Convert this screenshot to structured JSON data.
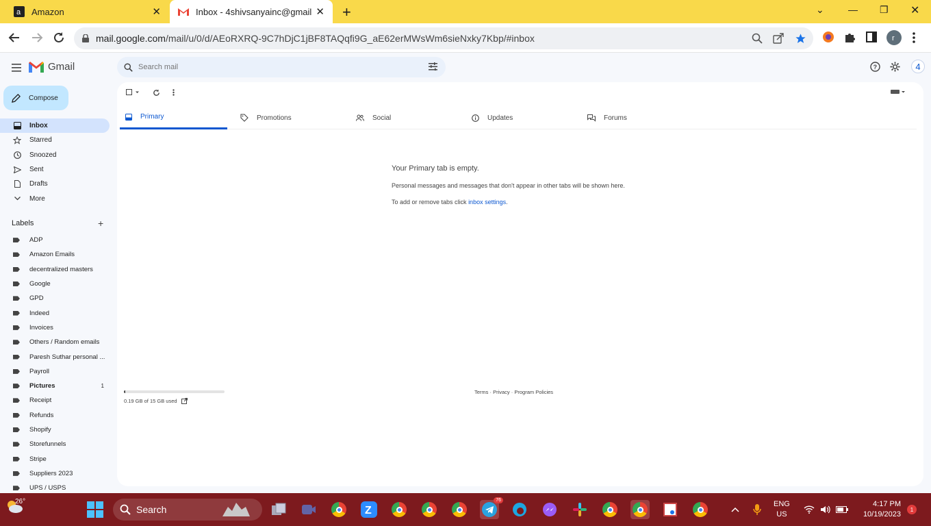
{
  "browser": {
    "tabs": [
      {
        "title": "Amazon"
      },
      {
        "title": "Inbox - 4shivsanyainc@gmail.com"
      }
    ],
    "url_domain": "mail.google.com",
    "url_path": "/mail/u/0/d/AEoRXRQ-9C7hDjC1jBF8TAQqfi9G_aE62erMWsWm6sieNxky7Kbp/#inbox",
    "profile_initial": "r"
  },
  "gmail": {
    "logo_text": "Gmail",
    "search_placeholder": "Search mail",
    "account_initial": "4",
    "compose_label": "Compose",
    "nav": [
      {
        "label": "Inbox"
      },
      {
        "label": "Starred"
      },
      {
        "label": "Snoozed"
      },
      {
        "label": "Sent"
      },
      {
        "label": "Drafts"
      },
      {
        "label": "More"
      }
    ],
    "labels_title": "Labels",
    "labels": [
      {
        "label": "ADP"
      },
      {
        "label": "Amazon Emails"
      },
      {
        "label": "decentralized masters"
      },
      {
        "label": "Google"
      },
      {
        "label": "GPD"
      },
      {
        "label": "Indeed"
      },
      {
        "label": "Invoices"
      },
      {
        "label": "Others / Random emails"
      },
      {
        "label": "Paresh Suthar personal ..."
      },
      {
        "label": "Payroll"
      },
      {
        "label": "Pictures",
        "count": "1"
      },
      {
        "label": "Receipt"
      },
      {
        "label": "Refunds"
      },
      {
        "label": "Shopify"
      },
      {
        "label": "Storefunnels"
      },
      {
        "label": "Stripe"
      },
      {
        "label": "Suppliers 2023"
      },
      {
        "label": "UPS / USPS"
      }
    ],
    "tabs": [
      {
        "label": "Primary"
      },
      {
        "label": "Promotions"
      },
      {
        "label": "Social"
      },
      {
        "label": "Updates"
      },
      {
        "label": "Forums"
      }
    ],
    "empty_title": "Your Primary tab is empty.",
    "empty_desc": "Personal messages and messages that don't appear in other tabs will be shown here.",
    "empty_hint_prefix": "To add or remove tabs click ",
    "empty_hint_link": "inbox settings",
    "empty_hint_suffix": ".",
    "storage_text": "0.19 GB of 15 GB used",
    "storage_fraction": 0.0127,
    "footer": {
      "terms": "Terms",
      "sep": " · ",
      "privacy": "Privacy",
      "policies": "Program Policies"
    }
  },
  "taskbar": {
    "weather_temp": "26°",
    "search_label": "Search",
    "telegram_badge": "76",
    "lang_top": "ENG",
    "lang_bottom": "US",
    "time": "4:17 PM",
    "date": "10/19/2023",
    "notification_count": "1"
  },
  "colors": {
    "accent": "#0b57d0",
    "compose_bg": "#c2e7ff",
    "active_nav": "#d3e3fd",
    "tabbar": "#f9d94a",
    "taskbar": "#7d1a1e"
  }
}
